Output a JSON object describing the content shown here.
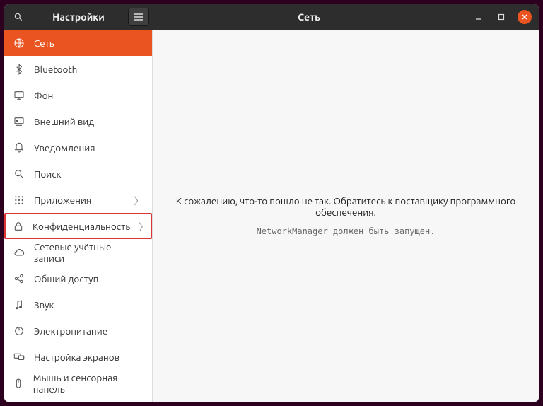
{
  "titlebar": {
    "left_title": "Настройки",
    "right_title": "Сеть"
  },
  "sidebar": {
    "items": [
      {
        "label": "Сеть",
        "icon": "globe",
        "selected": true,
        "chevron": false
      },
      {
        "label": "Bluetooth",
        "icon": "bluetooth",
        "selected": false,
        "chevron": false
      },
      {
        "label": "Фон",
        "icon": "monitor",
        "selected": false,
        "chevron": false
      },
      {
        "label": "Внешний вид",
        "icon": "appearance",
        "selected": false,
        "chevron": false
      },
      {
        "label": "Уведомления",
        "icon": "bell",
        "selected": false,
        "chevron": false
      },
      {
        "label": "Поиск",
        "icon": "search",
        "selected": false,
        "chevron": false
      },
      {
        "label": "Приложения",
        "icon": "apps",
        "selected": false,
        "chevron": true
      },
      {
        "label": "Конфиденциальность",
        "icon": "lock",
        "selected": false,
        "chevron": true,
        "highlighted": true
      },
      {
        "label": "Сетевые учётные записи",
        "icon": "cloud",
        "selected": false,
        "chevron": false
      },
      {
        "label": "Общий доступ",
        "icon": "share",
        "selected": false,
        "chevron": false
      },
      {
        "label": "Звук",
        "icon": "sound",
        "selected": false,
        "chevron": false
      },
      {
        "label": "Электропитание",
        "icon": "power",
        "selected": false,
        "chevron": false
      },
      {
        "label": "Настройка экранов",
        "icon": "displays",
        "selected": false,
        "chevron": false
      },
      {
        "label": "Мышь и сенсорная панель",
        "icon": "mouse",
        "selected": false,
        "chevron": false
      }
    ]
  },
  "content": {
    "error_main": "К сожалению, что-то пошло не так. Обратитесь к поставщику программного обеспечения.",
    "error_sub": "NetworkManager должен быть запущен."
  }
}
